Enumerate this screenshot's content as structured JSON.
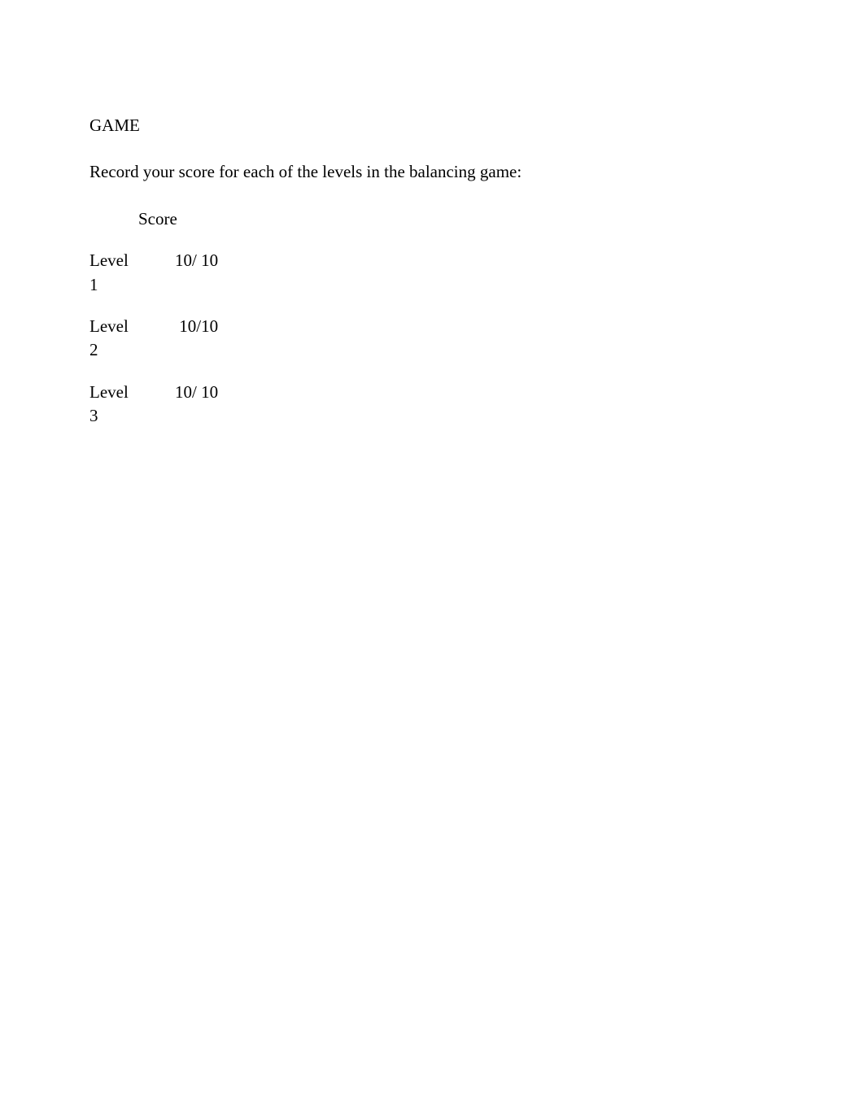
{
  "heading": "GAME",
  "instruction": "Record your score for each of the levels in the balancing game:",
  "score_header": "Score",
  "rows": [
    {
      "label": "Level 1",
      "score": "10/ 10"
    },
    {
      "label": "Level 2",
      "score": "10/10"
    },
    {
      "label": "Level 3",
      "score": "10/ 10"
    }
  ]
}
